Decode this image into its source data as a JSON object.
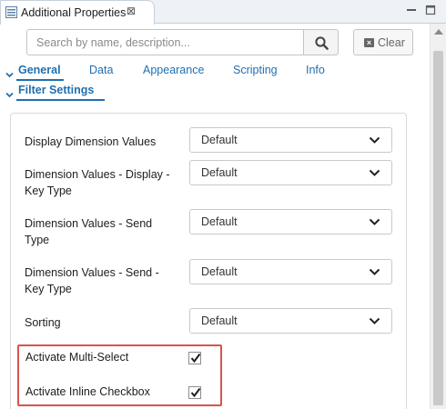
{
  "view_tab": {
    "title": "Additional Properties",
    "close_glyph": "⊠"
  },
  "search": {
    "placeholder": "Search by name, description...",
    "value": "",
    "clear_label": "Clear"
  },
  "category_tabs": [
    {
      "label": "General",
      "active": true
    },
    {
      "label": "Data",
      "active": false
    },
    {
      "label": "Appearance",
      "active": false
    },
    {
      "label": "Scripting",
      "active": false
    },
    {
      "label": "Info",
      "active": false
    }
  ],
  "section": {
    "label": "Filter Settings"
  },
  "properties": [
    {
      "label": "Display Dimension Values",
      "value": "Default"
    },
    {
      "label": "Dimension Values - Display - Key Type",
      "value": "Default"
    },
    {
      "label": "Dimension Values - Send Type",
      "value": "Default"
    },
    {
      "label": "Dimension Values - Send - Key Type",
      "value": "Default"
    },
    {
      "label": "Sorting",
      "value": "Default"
    }
  ],
  "checkboxes": [
    {
      "label": "Activate Multi-Select",
      "checked": true
    },
    {
      "label": "Activate Inline Checkbox",
      "checked": true
    }
  ],
  "colors": {
    "accent": "#1f6fb2",
    "highlight": "#d9534f"
  },
  "icons": [
    "properties-icon",
    "close-icon",
    "minimize-icon",
    "maximize-icon",
    "search-icon",
    "clear-icon",
    "chevron-down-icon",
    "checkmark-icon"
  ]
}
